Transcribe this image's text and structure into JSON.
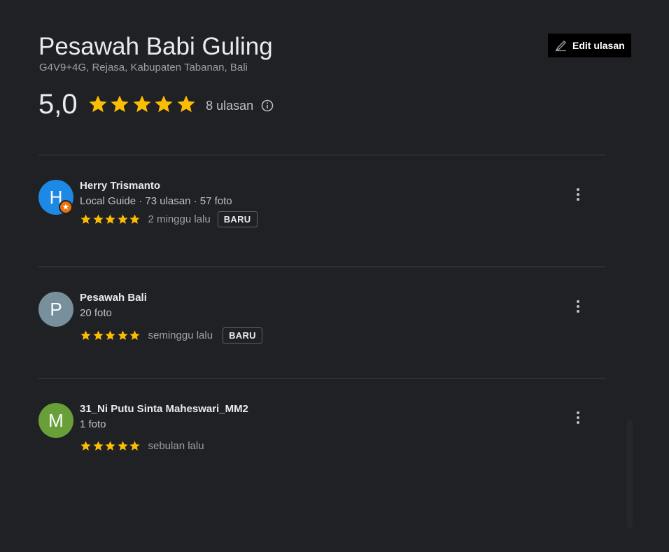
{
  "place": {
    "title": "Pesawah Babi Guling",
    "address": "G4V9+4G, Rejasa, Kabupaten Tabanan, Bali",
    "rating": "5,0",
    "stars": 5,
    "review_count": "8 ulasan"
  },
  "edit_button": {
    "label": "Edit ulasan",
    "icon": "pencil-icon"
  },
  "colors": {
    "background": "#202124",
    "star": "#fbbc04",
    "divider": "#3c4043",
    "edit_button_bg": "#000000"
  },
  "reviews": [
    {
      "name": "Herry Trismanto",
      "initial": "H",
      "avatar_color": "#1e88e5",
      "local_guide": true,
      "meta": "Local Guide · 73 ulasan · 57 foto",
      "stars": 5,
      "date": "2 minggu lalu",
      "badge": "BARU"
    },
    {
      "name": "Pesawah Bali",
      "initial": "P",
      "avatar_color": "#78909c",
      "local_guide": false,
      "meta": "20 foto",
      "stars": 5,
      "date": "seminggu lalu",
      "badge": "BARU"
    },
    {
      "name": "31_Ni Putu Sinta Maheswari_MM2",
      "initial": "M",
      "avatar_color": "#689f38",
      "local_guide": false,
      "meta": "1 foto",
      "stars": 5,
      "date": "sebulan lalu",
      "badge": ""
    }
  ]
}
